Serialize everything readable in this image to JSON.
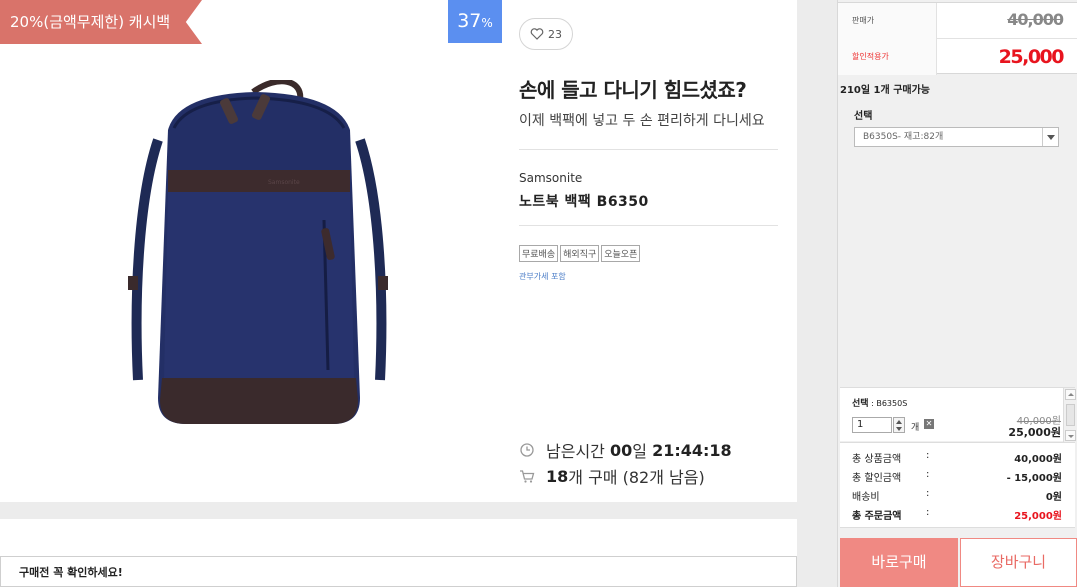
{
  "product": {
    "cashback_label": "20%(금액무제한) 캐시백",
    "discount_number": "37",
    "discount_unit": "%",
    "like_count": "23",
    "headline": "손에 들고 다니기 힘드셨죠?",
    "subline": "이제 백팩에 넣고 두 손 편리하게 다니세요",
    "brand": "Samsonite",
    "name": "노트북 백팩 B6350",
    "tags": [
      "무료배송",
      "해외직구",
      "오늘오픈"
    ],
    "tax_note": "관부가세 포함",
    "timer": {
      "label": "남은시간",
      "days": "00",
      "days_unit": "일",
      "time": "21:44:18"
    },
    "purchase": {
      "count": "18",
      "unit": "개 구매",
      "remaining": "(82개 남음)"
    }
  },
  "notice": {
    "text": "구매전 꼭 확인하세요!"
  },
  "order": {
    "price_label": "판매가",
    "price_value": "40,000",
    "sale_label": "할인적용가",
    "sale_value": "25,000",
    "limit_text": "210일 1개 구매가능",
    "select_label": "선택",
    "select_value": "B6350S- 재고:82개",
    "selected": {
      "label": "선택",
      "option": "B6350S",
      "qty": "1",
      "qty_unit": "개",
      "remove_icon": "x-icon",
      "orig_price": "40,000원",
      "price": "25,000원"
    },
    "summary": [
      {
        "label": "총 상품금액",
        "sep": ":",
        "value": "40,000원"
      },
      {
        "label": "총 할인금액",
        "sep": ":",
        "value": "- 15,000원"
      },
      {
        "label": "배송비",
        "sep": ":",
        "value": "0원"
      },
      {
        "label": "총 주문금액",
        "sep": ":",
        "value": "25,000원"
      }
    ],
    "buy_now_label": "바로구매",
    "cart_label": "장바구니"
  }
}
